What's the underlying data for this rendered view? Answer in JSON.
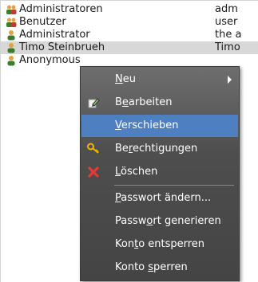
{
  "list": {
    "rows": [
      {
        "name": "Administratoren",
        "desc": "adm",
        "icon": "group-icon"
      },
      {
        "name": "Benutzer",
        "desc": "user",
        "icon": "group-icon"
      },
      {
        "name": "Administrator",
        "desc": "the a",
        "icon": "user-icon"
      },
      {
        "name": "Timo Steinbrueh",
        "desc": "Timo",
        "icon": "user-icon",
        "selected": true
      },
      {
        "name": "Anonymous",
        "desc": "",
        "icon": "user-icon"
      }
    ]
  },
  "menu": {
    "items": [
      {
        "label_pre": "",
        "label_u": "N",
        "label_post": "eu",
        "icon": "",
        "submenu": true
      },
      {
        "label_pre": "B",
        "label_u": "e",
        "label_post": "arbeiten",
        "icon": "edit-icon"
      },
      {
        "label_pre": "",
        "label_u": "V",
        "label_post": "erschieben",
        "icon": "",
        "highlighted": true
      },
      {
        "label_pre": "Be",
        "label_u": "r",
        "label_post": "echtigungen",
        "icon": "key-icon"
      },
      {
        "label_pre": "",
        "label_u": "L",
        "label_post": "öschen",
        "icon": "delete-icon"
      },
      {
        "label_pre": "",
        "label_u": "P",
        "label_post": "asswort ändern...",
        "icon": ""
      },
      {
        "label_pre": "Passw",
        "label_u": "o",
        "label_post": "rt generieren",
        "icon": ""
      },
      {
        "label_pre": "Kon",
        "label_u": "t",
        "label_post": "o entsperren",
        "icon": ""
      },
      {
        "label_pre": "Konto ",
        "label_u": "s",
        "label_post": "perren",
        "icon": ""
      }
    ]
  },
  "colors": {
    "highlight": "#4e7fc1",
    "selected_row": "#d8d8d8"
  }
}
